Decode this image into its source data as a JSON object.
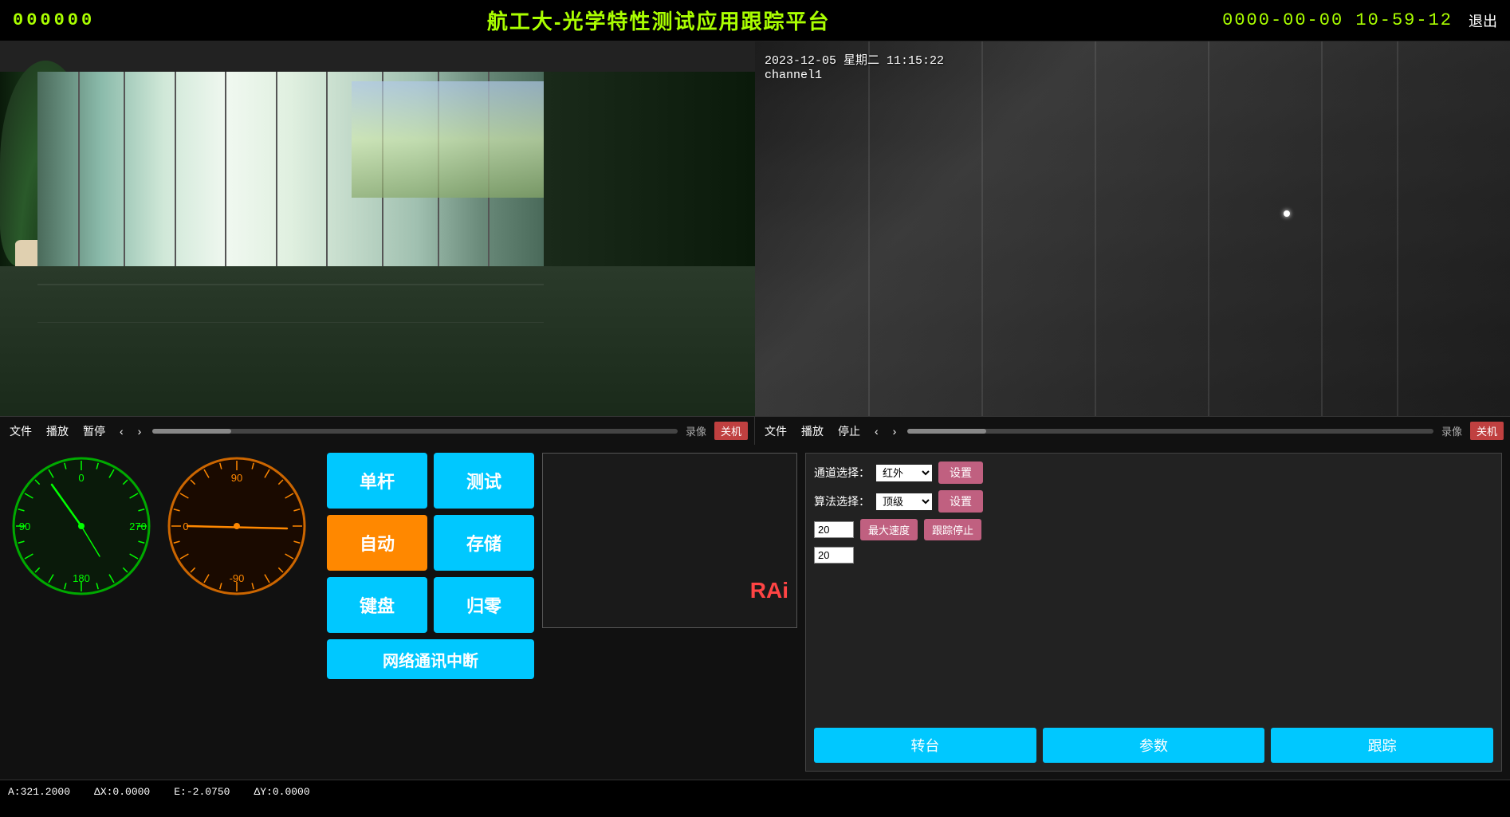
{
  "header": {
    "system_id": "000000",
    "title": "航工大-光学特性测试应用跟踪平台",
    "datetime": "0000-00-00 10-59-12",
    "exit_label": "退出"
  },
  "video_left": {
    "timestamp": "",
    "channel": ""
  },
  "video_right": {
    "timestamp": "2023-12-05 星期二 11:15:22",
    "channel": "channel1"
  },
  "control_bar_left": {
    "file": "文件",
    "play": "播放",
    "pause": "暂停",
    "prev": "‹",
    "next": "›",
    "record": "录像",
    "shutdown": "关机"
  },
  "control_bar_right": {
    "file": "文件",
    "play": "播放",
    "stop": "停止",
    "prev": "‹",
    "next": "›",
    "record": "录像",
    "shutdown": "关机"
  },
  "buttons": {
    "single_pole": "单杆",
    "test": "测试",
    "auto": "自动",
    "store": "存储",
    "keyboard": "键盘",
    "reset": "归零",
    "network_interrupt": "网络通讯中断"
  },
  "right_panel": {
    "channel_label": "通道选择：",
    "channel_value": "红外",
    "algo_label": "算法选择：",
    "algo_value": "顶级",
    "set_label": "设置",
    "input1_value": "20",
    "input2_value": "20",
    "max_speed_label": "最大速度",
    "stop_trace_label": "跟踪停止",
    "turntable_label": "转台",
    "params_label": "参数",
    "trace_label": "跟踪"
  },
  "gauge_left": {
    "center_label": "0",
    "left_label": "90",
    "right_label": "270",
    "bottom_label": "180"
  },
  "gauge_right": {
    "top_label": "90",
    "left_label": "0",
    "bottom_label": "-90"
  },
  "status_bar": {
    "a_value": "A:321.2000",
    "ax_value": "ΔX:0.0000",
    "e_value": "E:-2.0750",
    "ay_value": "ΔY:0.0000"
  },
  "rai_text": "RAi"
}
